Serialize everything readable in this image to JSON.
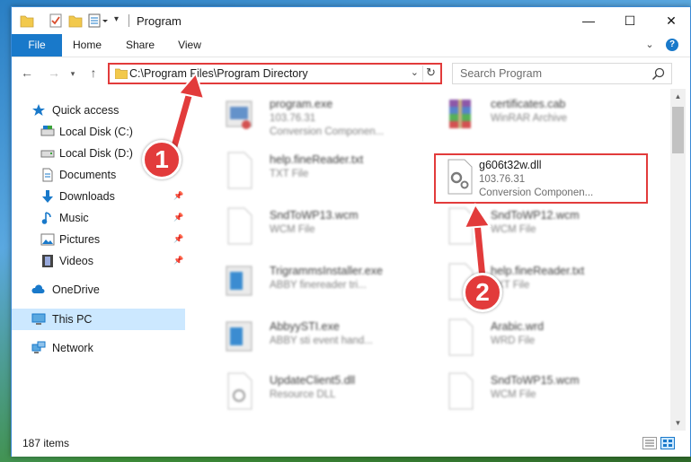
{
  "window": {
    "title": "Program",
    "controls": {
      "minimize": "—",
      "maximize": "☐",
      "close": "✕"
    }
  },
  "ribbon": {
    "tabs": [
      "File",
      "Home",
      "Share",
      "View"
    ],
    "help": "?"
  },
  "navigation": {
    "address": "C:\\Program Files\\Program Directory",
    "search_placeholder": "Search Program"
  },
  "sidebar": {
    "items": [
      {
        "label": "Quick access",
        "icon": "star-icon"
      },
      {
        "label": "Local Disk (C:)",
        "icon": "drive-icon"
      },
      {
        "label": "Local Disk (D:)",
        "icon": "drive-icon"
      },
      {
        "label": "Documents",
        "icon": "documents-icon"
      },
      {
        "label": "Downloads",
        "icon": "download-icon",
        "pinned": true
      },
      {
        "label": "Music",
        "icon": "music-icon",
        "pinned": true
      },
      {
        "label": "Pictures",
        "icon": "pictures-icon",
        "pinned": true
      },
      {
        "label": "Videos",
        "icon": "videos-icon",
        "pinned": true
      },
      {
        "label": "OneDrive",
        "icon": "cloud-icon"
      },
      {
        "label": "This PC",
        "icon": "computer-icon",
        "selected": true
      },
      {
        "label": "Network",
        "icon": "network-icon"
      }
    ]
  },
  "files": [
    {
      "name": "program.exe",
      "line1": "103.76.31",
      "line2": "Conversion Componen...",
      "icon": "exe-icon"
    },
    {
      "name": "certificates.cab",
      "line1": "WinRAR Archive",
      "line2": "",
      "icon": "archive-icon"
    },
    {
      "name": "help.fineReader.txt",
      "line1": "TXT File",
      "line2": "",
      "icon": "document-icon"
    },
    {
      "name": "g606t32w.dll",
      "line1": "103.76.31",
      "line2": "Conversion Componen...",
      "icon": "dll-icon",
      "highlighted": true
    },
    {
      "name": "SndToWP13.wcm",
      "line1": "WCM File",
      "line2": "",
      "icon": "document-icon"
    },
    {
      "name": "SndToWP12.wcm",
      "line1": "WCM File",
      "line2": "",
      "icon": "document-icon"
    },
    {
      "name": "TrigrammsInstaller.exe",
      "line1": "ABBY finereader tri...",
      "line2": "",
      "icon": "installer-icon"
    },
    {
      "name": "help.fineReader.txt",
      "line1": "TXT File",
      "line2": "",
      "icon": "document-icon"
    },
    {
      "name": "AbbyySTI.exe",
      "line1": "ABBY sti event hand...",
      "line2": "",
      "icon": "installer-icon"
    },
    {
      "name": "Arabic.wrd",
      "line1": "WRD File",
      "line2": "",
      "icon": "document-icon"
    },
    {
      "name": "UpdateClient5.dll",
      "line1": "Resource DLL",
      "line2": "",
      "icon": "dll-icon"
    },
    {
      "name": "SndToWP15.wcm",
      "line1": "WCM File",
      "line2": "",
      "icon": "document-icon"
    }
  ],
  "status": {
    "items_count": "187 items"
  },
  "annotations": {
    "step1": "1",
    "step2": "2"
  },
  "colors": {
    "accent": "#1979ca",
    "annotation": "#e23b3b",
    "selected": "#cce8ff"
  }
}
